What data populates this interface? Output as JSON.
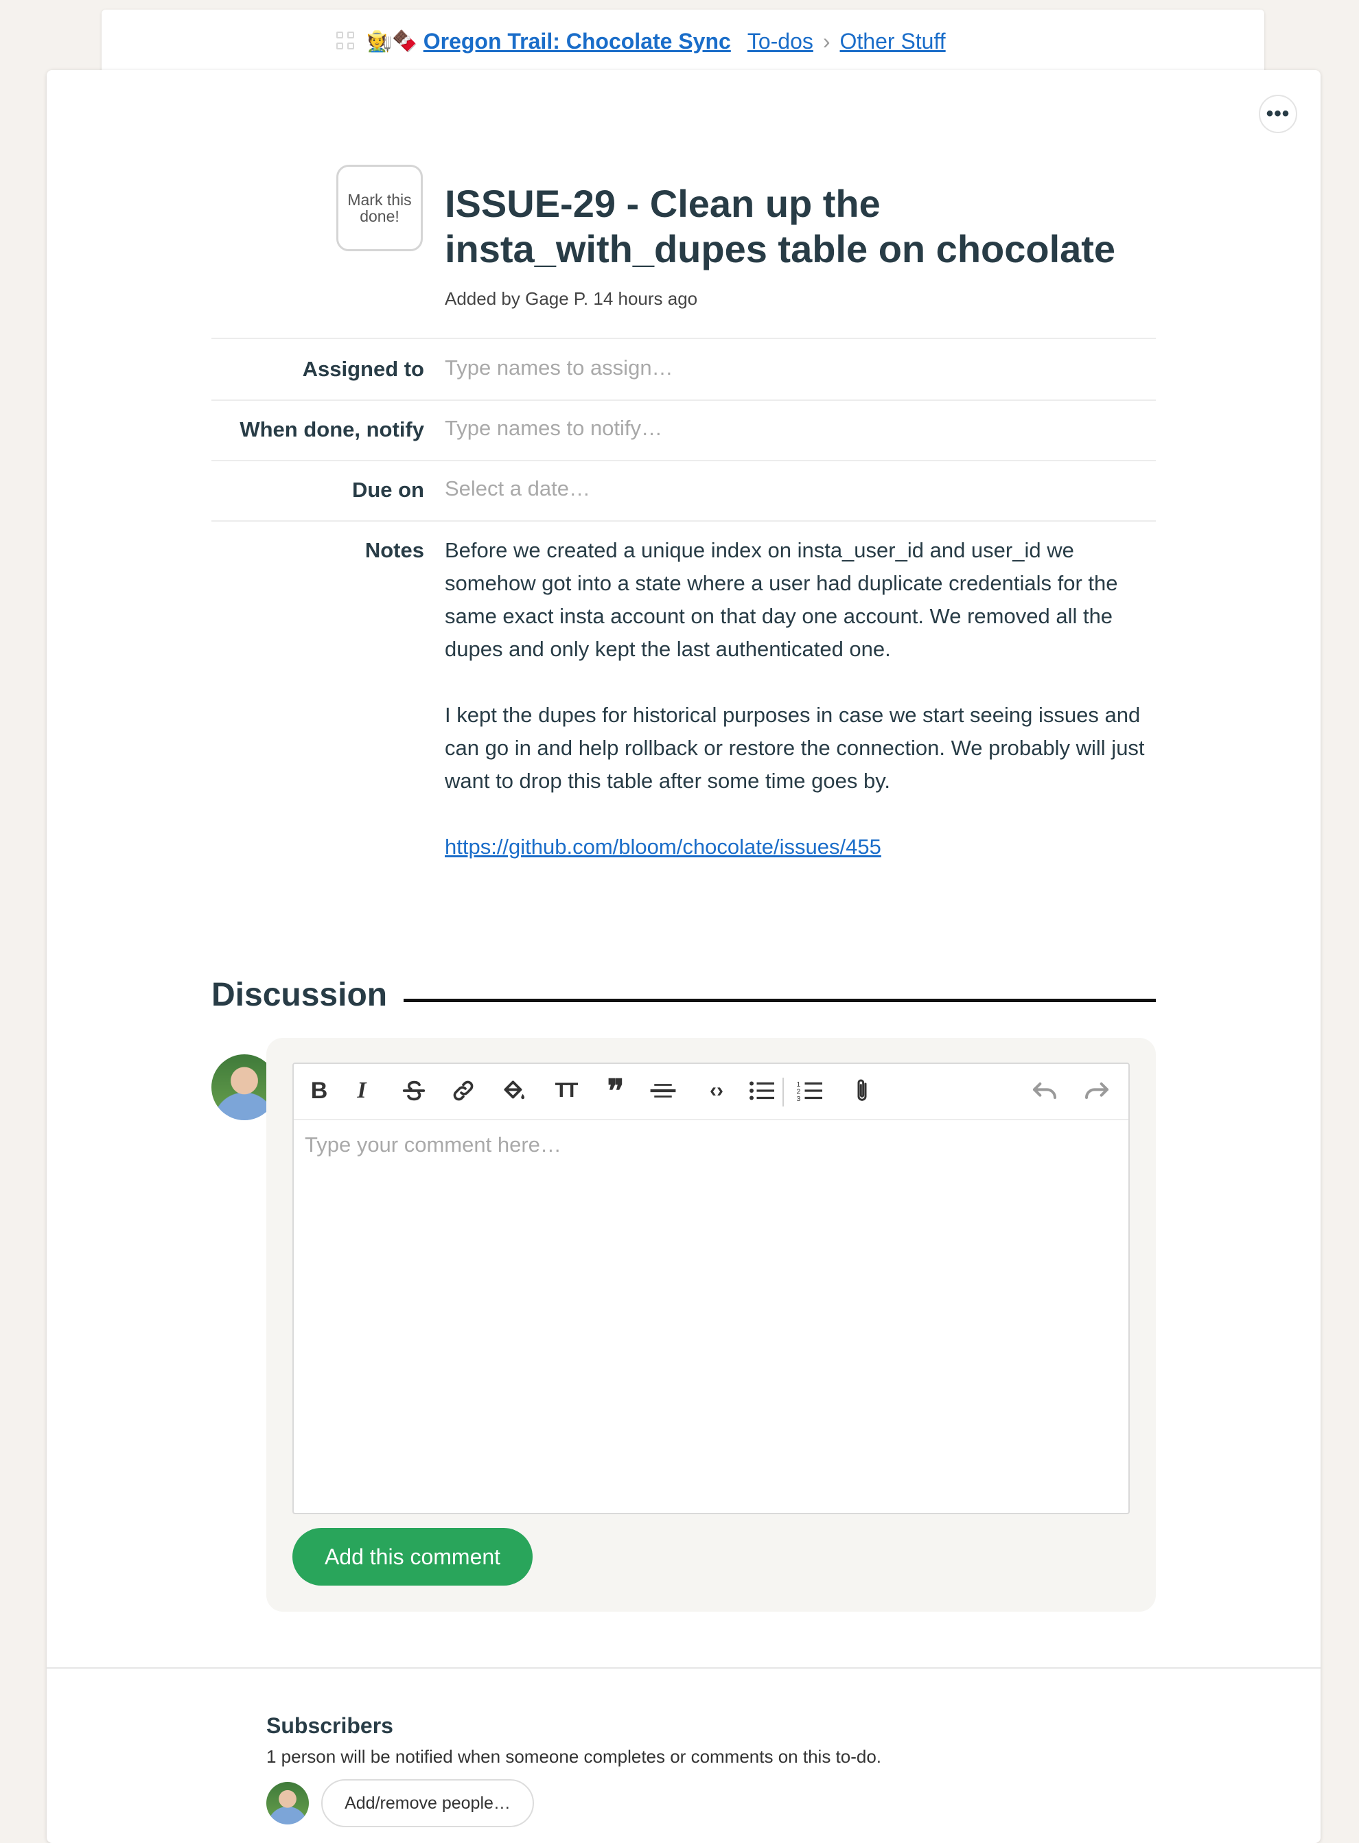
{
  "breadcrumb": {
    "project_emoji": "🧑‍🌾🍫",
    "project_name": "Oregon Trail: Chocolate Sync",
    "todos_link": "To-dos",
    "separator": "›",
    "list_link": "Other Stuff"
  },
  "todo": {
    "mark_done_label": "Mark this done!",
    "title": "ISSUE-29 - Clean up the insta_with_dupes table on chocolate",
    "added_by": "Added by Gage P. 14 hours ago"
  },
  "fields": {
    "assigned_label": "Assigned to",
    "assigned_placeholder": "Type names to assign…",
    "notify_label": "When done, notify",
    "notify_placeholder": "Type names to notify…",
    "due_label": "Due on",
    "due_placeholder": "Select a date…",
    "notes_label": "Notes"
  },
  "notes": {
    "paragraph1": "Before we created a unique index on insta_user_id and user_id we somehow got into a state where a user had duplicate credentials for the same exact insta account on that day one account. We removed all the dupes and only kept the last authenticated one.",
    "paragraph2": "I kept the dupes for historical purposes in case we start seeing issues and can go in and help rollback or restore the connection. We probably will just want to drop this table after some time goes by.",
    "link": "https://github.com/bloom/chocolate/issues/455"
  },
  "discussion": {
    "heading": "Discussion",
    "comment_placeholder": "Type your comment here…",
    "submit_label": "Add this comment",
    "toolbar": {
      "bold": "B",
      "italic": "I",
      "heading": "TT",
      "quote": "❞",
      "code": "‹›"
    }
  },
  "subscribers": {
    "heading": "Subscribers",
    "note": "1 person will be notified when someone completes or comments on this to-do.",
    "add_remove_label": "Add/remove people…"
  },
  "more_menu": "•••",
  "colors": {
    "link": "#1a6dc9",
    "submit_green": "#29a55b",
    "text_dark": "#283c46",
    "page_bg": "#f5f2ee"
  }
}
